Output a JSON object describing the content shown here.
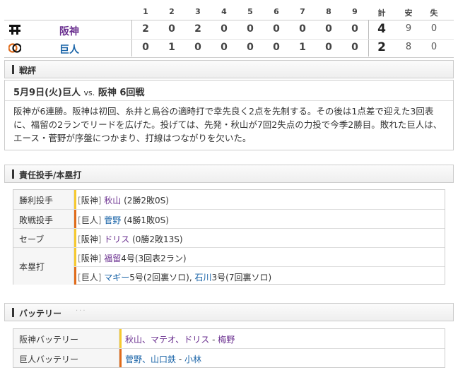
{
  "scoreboard": {
    "headers": [
      "1",
      "2",
      "3",
      "4",
      "5",
      "6",
      "7",
      "8",
      "9",
      "計",
      "安",
      "失"
    ],
    "teams": [
      {
        "name": "阪神",
        "color": "#6a2f8f",
        "innings": [
          "2",
          "0",
          "2",
          "0",
          "0",
          "0",
          "0",
          "0",
          "0"
        ],
        "total": "4",
        "hits": "9",
        "errors": "0",
        "logo": "tigers-logo"
      },
      {
        "name": "巨人",
        "color": "#1a64a8",
        "innings": [
          "0",
          "1",
          "0",
          "0",
          "0",
          "0",
          "1",
          "0",
          "0"
        ],
        "total": "2",
        "hits": "8",
        "errors": "0",
        "logo": "giants-logo"
      }
    ]
  },
  "summary": {
    "section_title": "戦評",
    "game_date": "5月9日(火)",
    "game_home": "巨人",
    "game_vs": "vs.",
    "game_away": "阪神 6回戦",
    "text": "阪神が6連勝。阪神は初回、糸井と鳥谷の適時打で幸先良く2点を先制する。その後は1点差で迎えた3回表に、福留の2ランでリードを広げた。投げては、先発・秋山が7回2失点の力投で今季2勝目。敗れた巨人は、エース・菅野が序盤につかまり、打線はつながりを欠いた。"
  },
  "pitchers": {
    "section_title": "責任投手/本塁打",
    "win": {
      "label": "勝利投手",
      "team": "阪神",
      "player": "秋山",
      "stat": "(2勝2敗0S)"
    },
    "loss": {
      "label": "敗戦投手",
      "team": "巨人",
      "player": "菅野",
      "stat": "(4勝1敗0S)"
    },
    "save": {
      "label": "セーブ",
      "team": "阪神",
      "player": "ドリス",
      "stat": "(0勝2敗13S)"
    },
    "hr_label": "本塁打",
    "hr_tigers": {
      "team": "阪神",
      "player": "福留",
      "stat": "4号(3回表2ラン)"
    },
    "hr_giants": {
      "team": "巨人",
      "player1": "マギー",
      "stat1": "5号(2回裏ソロ),",
      "player2": "石川",
      "stat2": "3号(7回裏ソロ)"
    }
  },
  "battery": {
    "section_title": "バッテリー",
    "tigers": {
      "label": "阪神バッテリー",
      "pitchers": "秋山、マテオ、ドリス",
      "catcher": "梅野"
    },
    "giants": {
      "label": "巨人バッテリー",
      "pitchers": "菅野、山口鉄",
      "catcher": "小林"
    }
  }
}
